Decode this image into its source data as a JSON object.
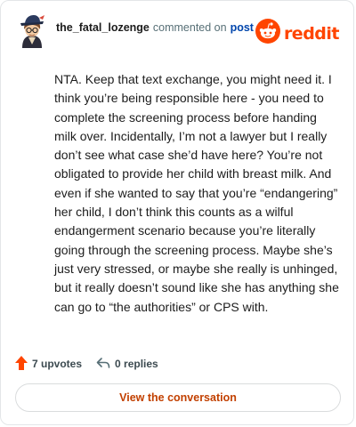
{
  "comment": {
    "username": "the_fatal_lozenge",
    "action_text": "commented on",
    "post_link_text": "post",
    "body": "NTA. Keep that text exchange, you might need it. I think you’re being responsible here - you need to complete the screening process before handing milk over. Incidentally, I’m not a lawyer but I really don’t see what case she’d have here? You’re not obligated to provide her child with breast milk. And even if she wanted to say that you’re “endangering” her child, I don’t think this counts as a wilful endangerment scenario because you’re literally going through the screening process. Maybe she’s just very stressed, or maybe she really is unhinged, but it really doesn’t sound like she has anything she can go to “the authorities” or CPS with."
  },
  "brand": {
    "name": "reddit",
    "icon": "reddit-snoo-icon",
    "color": "#ff4500"
  },
  "footer": {
    "upvotes_text": "7 upvotes",
    "upvote_icon": "upvote-arrow-icon",
    "replies_text": "0 replies",
    "reply_icon": "reply-arrow-icon"
  },
  "view_button": {
    "label": "View the conversation"
  },
  "colors": {
    "accent": "#ff4500",
    "link": "#0045ac",
    "button_text": "#c24000",
    "border": "#e3e6e8"
  }
}
